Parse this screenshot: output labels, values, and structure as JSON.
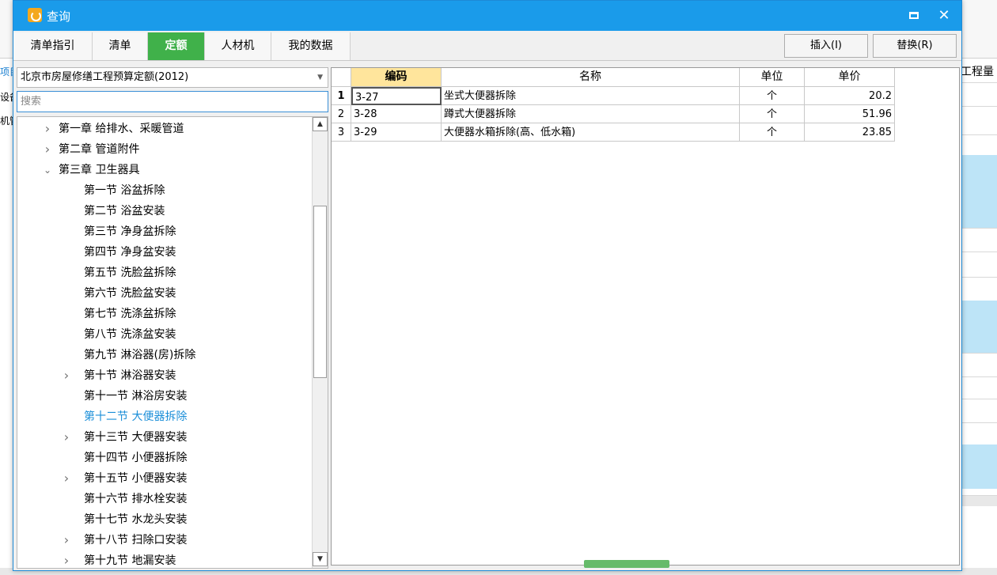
{
  "background_app": {
    "left_labels": [
      "项目",
      "设备",
      "机管"
    ],
    "right_header": "工程量"
  },
  "dialog": {
    "title": "查询",
    "tabs": [
      {
        "label": "清单指引",
        "active": false
      },
      {
        "label": "清单",
        "active": false
      },
      {
        "label": "定额",
        "active": true
      },
      {
        "label": "人材机",
        "active": false
      },
      {
        "label": "我的数据",
        "active": false
      }
    ],
    "insert_button": "插入(I)",
    "replace_button": "替换(R)",
    "quota_library": "北京市房屋修缮工程预算定额(2012)",
    "search_placeholder": "搜索",
    "tree": [
      {
        "label": "第一章 给排水、采暖管道",
        "level": 0,
        "expander": "collapsed"
      },
      {
        "label": "第二章 管道附件",
        "level": 0,
        "expander": "collapsed"
      },
      {
        "label": "第三章 卫生器具",
        "level": 0,
        "expander": "expanded"
      },
      {
        "label": "第一节 浴盆拆除",
        "level": 1,
        "expander": "none"
      },
      {
        "label": "第二节 浴盆安装",
        "level": 1,
        "expander": "none"
      },
      {
        "label": "第三节 净身盆拆除",
        "level": 1,
        "expander": "none"
      },
      {
        "label": "第四节 净身盆安装",
        "level": 1,
        "expander": "none"
      },
      {
        "label": "第五节 洗脸盆拆除",
        "level": 1,
        "expander": "none"
      },
      {
        "label": "第六节 洗脸盆安装",
        "level": 1,
        "expander": "none"
      },
      {
        "label": "第七节 洗涤盆拆除",
        "level": 1,
        "expander": "none"
      },
      {
        "label": "第八节 洗涤盆安装",
        "level": 1,
        "expander": "none"
      },
      {
        "label": "第九节 淋浴器(房)拆除",
        "level": 1,
        "expander": "none"
      },
      {
        "label": "第十节 淋浴器安装",
        "level": 1,
        "expander": "collapsed"
      },
      {
        "label": "第十一节 淋浴房安装",
        "level": 1,
        "expander": "none"
      },
      {
        "label": "第十二节 大便器拆除",
        "level": 1,
        "expander": "none",
        "selected": true
      },
      {
        "label": "第十三节 大便器安装",
        "level": 1,
        "expander": "collapsed"
      },
      {
        "label": "第十四节 小便器拆除",
        "level": 1,
        "expander": "none"
      },
      {
        "label": "第十五节 小便器安装",
        "level": 1,
        "expander": "collapsed"
      },
      {
        "label": "第十六节 排水栓安装",
        "level": 1,
        "expander": "none"
      },
      {
        "label": "第十七节 水龙头安装",
        "level": 1,
        "expander": "none"
      },
      {
        "label": "第十八节 扫除口安装",
        "level": 1,
        "expander": "collapsed"
      },
      {
        "label": "第十九节 地漏安装",
        "level": 1,
        "expander": "collapsed"
      }
    ],
    "grid": {
      "columns": [
        "编码",
        "名称",
        "单位",
        "单价"
      ],
      "rows": [
        {
          "num": "1",
          "code": "3-27",
          "name": "坐式大便器拆除",
          "unit": "个",
          "price": "20.2"
        },
        {
          "num": "2",
          "code": "3-28",
          "name": "蹲式大便器拆除",
          "unit": "个",
          "price": "51.96"
        },
        {
          "num": "3",
          "code": "3-29",
          "name": "大便器水箱拆除(高、低水箱)",
          "unit": "个",
          "price": "23.85"
        }
      ]
    }
  },
  "icons": {
    "app": "app-logo-icon",
    "maximize": "maximize-icon",
    "close": "close-icon",
    "expand": "chevron-right-icon",
    "collapse": "chevron-down-icon"
  },
  "colors": {
    "titlebar": "#1a9bea",
    "active_tab": "#40b14a",
    "sorted_header": "#ffe59c",
    "selected_tree_item": "#1a8ed8"
  }
}
